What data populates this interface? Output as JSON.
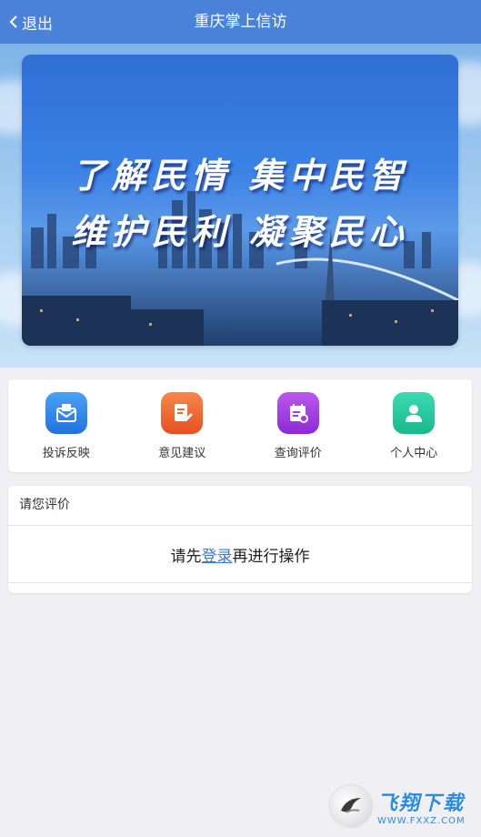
{
  "header": {
    "back_label": "退出",
    "title": "重庆掌上信访"
  },
  "banner": {
    "line1": "了解民情  集中民智",
    "line2": "维护民利  凝聚民心"
  },
  "menu": {
    "items": [
      {
        "label": "投诉反映",
        "icon": "complaint-envelope-icon",
        "color": "#2f86e8"
      },
      {
        "label": "意见建议",
        "icon": "suggestion-edit-icon",
        "color": "#f0662e"
      },
      {
        "label": "查询评价",
        "icon": "query-calendar-icon",
        "color": "#a23be0"
      },
      {
        "label": "个人中心",
        "icon": "person-icon",
        "color": "#26c8a0"
      }
    ]
  },
  "evaluation": {
    "heading": "请您评价",
    "prompt_before": "请先",
    "login_link": "登录",
    "prompt_after": "再进行操作"
  },
  "watermark": {
    "name": "飞翔下载",
    "url": "WWW.FXXZ.COM"
  }
}
